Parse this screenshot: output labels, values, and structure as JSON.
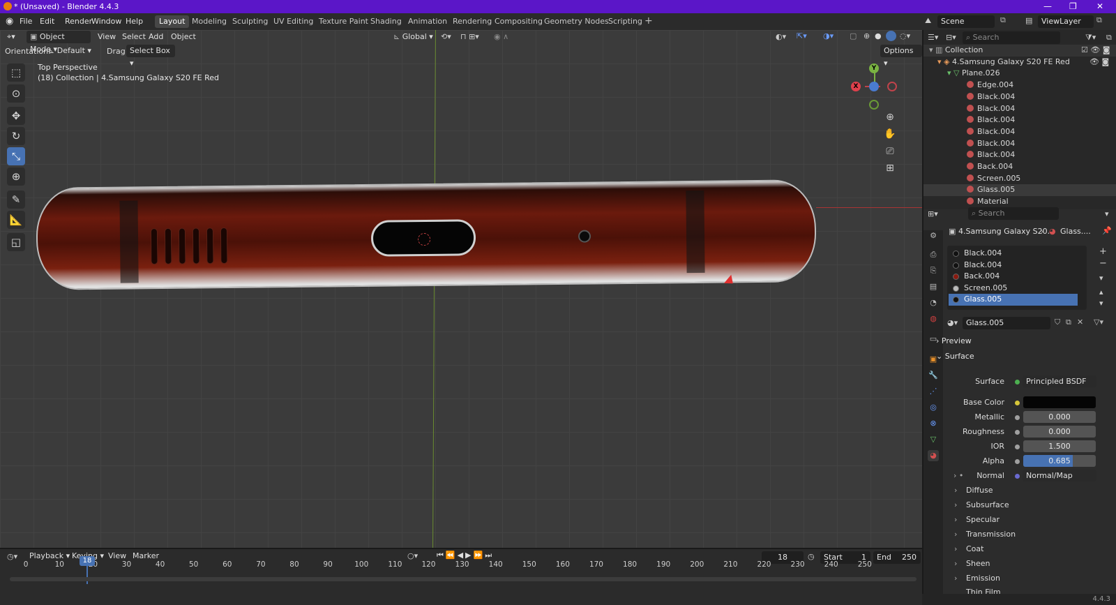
{
  "window": {
    "title": "* (Unsaved) - Blender 4.4.3",
    "controls": [
      "—",
      "❐",
      "✕"
    ]
  },
  "menu": [
    "File",
    "Edit",
    "Render",
    "Window",
    "Help"
  ],
  "workspaces": [
    "Layout",
    "Modeling",
    "Sculpting",
    "UV Editing",
    "Texture Paint",
    "Shading",
    "Animation",
    "Rendering",
    "Compositing",
    "Geometry Nodes",
    "Scripting"
  ],
  "active_workspace": "Layout",
  "scene": {
    "label": "Scene",
    "view_layer": "ViewLayer"
  },
  "viewport": {
    "mode": "Object Mode",
    "menus": [
      "View",
      "Select",
      "Add",
      "Object"
    ],
    "transform_orientation": "Global",
    "orientation_label": "Orientation:",
    "orientation_value": "Default",
    "drag_label": "Drag:",
    "drag_value": "Select Box",
    "options_label": "Options",
    "view_name": "Top Perspective",
    "view_context": "(18) Collection | 4.Samsung Galaxy S20 FE Red",
    "gizmo_axes": [
      "X",
      "Y"
    ]
  },
  "outliner": {
    "search_placeholder": "Search",
    "items": [
      {
        "label": "Collection",
        "level": 0
      },
      {
        "label": "4.Samsung Galaxy S20 FE Red",
        "level": 1
      },
      {
        "label": "Plane.026",
        "level": 2
      },
      {
        "label": "Edge.004",
        "level": 3
      },
      {
        "label": "Black.004",
        "level": 3
      },
      {
        "label": "Black.004",
        "level": 3
      },
      {
        "label": "Black.004",
        "level": 3
      },
      {
        "label": "Black.004",
        "level": 3
      },
      {
        "label": "Black.004",
        "level": 3
      },
      {
        "label": "Black.004",
        "level": 3
      },
      {
        "label": "Back.004",
        "level": 3
      },
      {
        "label": "Screen.005",
        "level": 3
      },
      {
        "label": "Glass.005",
        "level": 3
      },
      {
        "label": "Material",
        "level": 3
      }
    ]
  },
  "properties": {
    "search_placeholder": "Search",
    "breadcrumb_object": "4.Samsung Galaxy S20...",
    "breadcrumb_material": "Glass....",
    "slots": [
      "Black.004",
      "Black.004",
      "Back.004",
      "Screen.005",
      "Glass.005"
    ],
    "active_slot": "Glass.005",
    "material_name": "Glass.005",
    "panels": {
      "preview": "Preview",
      "surface": "Surface"
    },
    "surface_label": "Surface",
    "surface_value": "Principled BSDF",
    "inputs": [
      {
        "label": "Base Color",
        "value": ""
      },
      {
        "label": "Metallic",
        "value": "0.000"
      },
      {
        "label": "Roughness",
        "value": "0.000"
      },
      {
        "label": "IOR",
        "value": "1.500"
      },
      {
        "label": "Alpha",
        "value": "0.685",
        "fraction": 0.685
      }
    ],
    "normal_label": "Normal",
    "normal_value": "Normal/Map",
    "subpanels": [
      "Diffuse",
      "Subsurface",
      "Specular",
      "Transmission",
      "Coat",
      "Sheen",
      "Emission",
      "Thin Film"
    ],
    "base_color_hex": "#050505",
    "accent": "#4772b3"
  },
  "timeline": {
    "menus": [
      "Playback",
      "Keying",
      "View",
      "Marker"
    ],
    "current_frame": "18",
    "start_label": "Start",
    "start_value": "1",
    "end_label": "End",
    "end_value": "250",
    "ticks": [
      "0",
      "10",
      "20",
      "30",
      "40",
      "50",
      "60",
      "70",
      "80",
      "90",
      "100",
      "110",
      "120",
      "130",
      "140",
      "150",
      "160",
      "170",
      "180",
      "190",
      "200",
      "210",
      "220",
      "230",
      "240",
      "250"
    ],
    "playhead_label": "18"
  },
  "status": {
    "version": "4.4.3"
  }
}
